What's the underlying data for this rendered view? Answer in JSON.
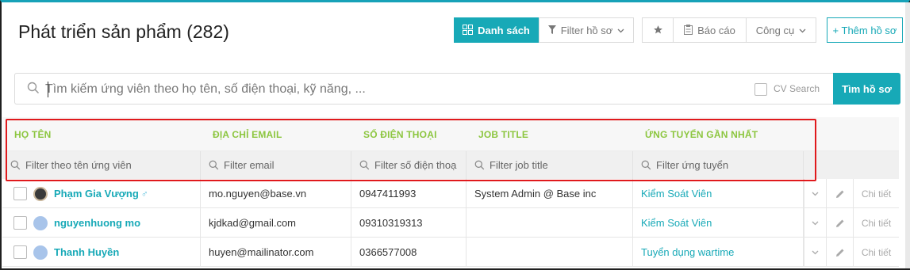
{
  "page": {
    "title": "Phát triển sản phẩm (282)"
  },
  "toolbar": {
    "list_label": "Danh sách",
    "filter_label": "Filter hồ sơ",
    "report_label": "Báo cáo",
    "tools_label": "Công cụ",
    "add_label": "+ Thêm hồ sơ"
  },
  "search": {
    "placeholder": "Tìm kiếm ứng viên theo họ tên, số điện thoại, kỹ năng, ...",
    "cv_search_label": "CV Search",
    "button_label": "Tìm hồ sơ"
  },
  "table": {
    "columns": [
      "HỌ TÊN",
      "ĐỊA CHỈ EMAIL",
      "SỐ ĐIỆN THOẠI",
      "JOB TITLE",
      "ỨNG TUYỂN GẦN NHẤT"
    ],
    "filters": [
      "Filter theo tên ứng viên",
      "Filter email",
      "Filter số điện thoạ",
      "Filter job title",
      "Filter ứng tuyển"
    ],
    "rows": [
      {
        "name": "Phạm Gia Vượng",
        "gender": "♂",
        "email": "mo.nguyen@base.vn",
        "phone": "0947411993",
        "job_title": "System Admin @ Base inc",
        "applied": "Kiểm Soát Viên",
        "detail": "Chi tiết"
      },
      {
        "name": "nguyenhuong mo",
        "gender": "",
        "email": "kjdkad@gmail.com",
        "phone": "09310319313",
        "job_title": "",
        "applied": "Kiểm Soát Viên",
        "detail": "Chi tiết"
      },
      {
        "name": "Thanh Huyền",
        "gender": "",
        "email": "huyen@mailinator.com",
        "phone": "0366577008",
        "job_title": "",
        "applied": "Tuyển dụng wartime",
        "detail": "Chi tiết"
      }
    ]
  },
  "colors": {
    "accent": "#17a9b7",
    "header_text": "#8cc63f",
    "highlight_border": "#e0191c"
  }
}
